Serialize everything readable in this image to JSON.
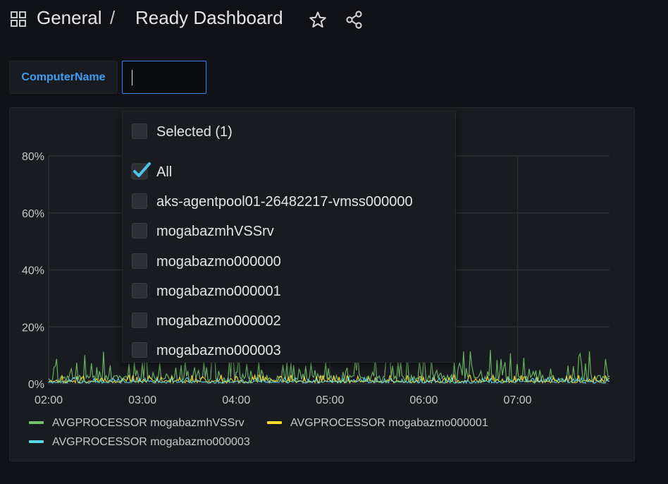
{
  "header": {
    "breadcrumb_folder": "General",
    "breadcrumb_separator": "/",
    "dashboard_title": "Ready Dashboard",
    "icons": [
      "grid-icon",
      "star-icon",
      "share-icon"
    ]
  },
  "variable": {
    "label": "ComputerName",
    "input_value": ""
  },
  "dropdown": {
    "selected_header": "Selected (1)",
    "options": [
      {
        "label": "All",
        "checked": true
      },
      {
        "label": "aks-agentpool01-26482217-vmss000000",
        "checked": false
      },
      {
        "label": "mogabazmhVSSrv",
        "checked": false
      },
      {
        "label": "mogabazmo000000",
        "checked": false
      },
      {
        "label": "mogabazmo000001",
        "checked": false
      },
      {
        "label": "mogabazmo000002",
        "checked": false
      },
      {
        "label": "mogabazmo000003",
        "checked": false
      }
    ]
  },
  "chart_data": {
    "type": "line",
    "y_ticks": [
      "0%",
      "20%",
      "40%",
      "60%",
      "80%"
    ],
    "x_ticks": [
      "02:00",
      "03:00",
      "04:00",
      "05:00",
      "06:00",
      "07:00"
    ],
    "ylim": [
      0,
      80
    ],
    "xlim_hours": [
      2.0,
      7.98
    ],
    "grid": true,
    "legend_position": "bottom",
    "series": [
      {
        "name": "AVGPROCESSOR mogabazmhVSSrv",
        "color": "#73bf69",
        "baseline": 2.5,
        "spike_max": 12
      },
      {
        "name": "AVGPROCESSOR mogabazmo000001",
        "color": "#fade2a",
        "baseline": 1.0,
        "spike_max": 4
      },
      {
        "name": "AVGPROCESSOR mogabazmo000003",
        "color": "#5ad8ea",
        "baseline": 0.8,
        "spike_max": 3
      }
    ]
  },
  "colors": {
    "accent": "#3d9df2",
    "check": "#4cc4e8"
  }
}
